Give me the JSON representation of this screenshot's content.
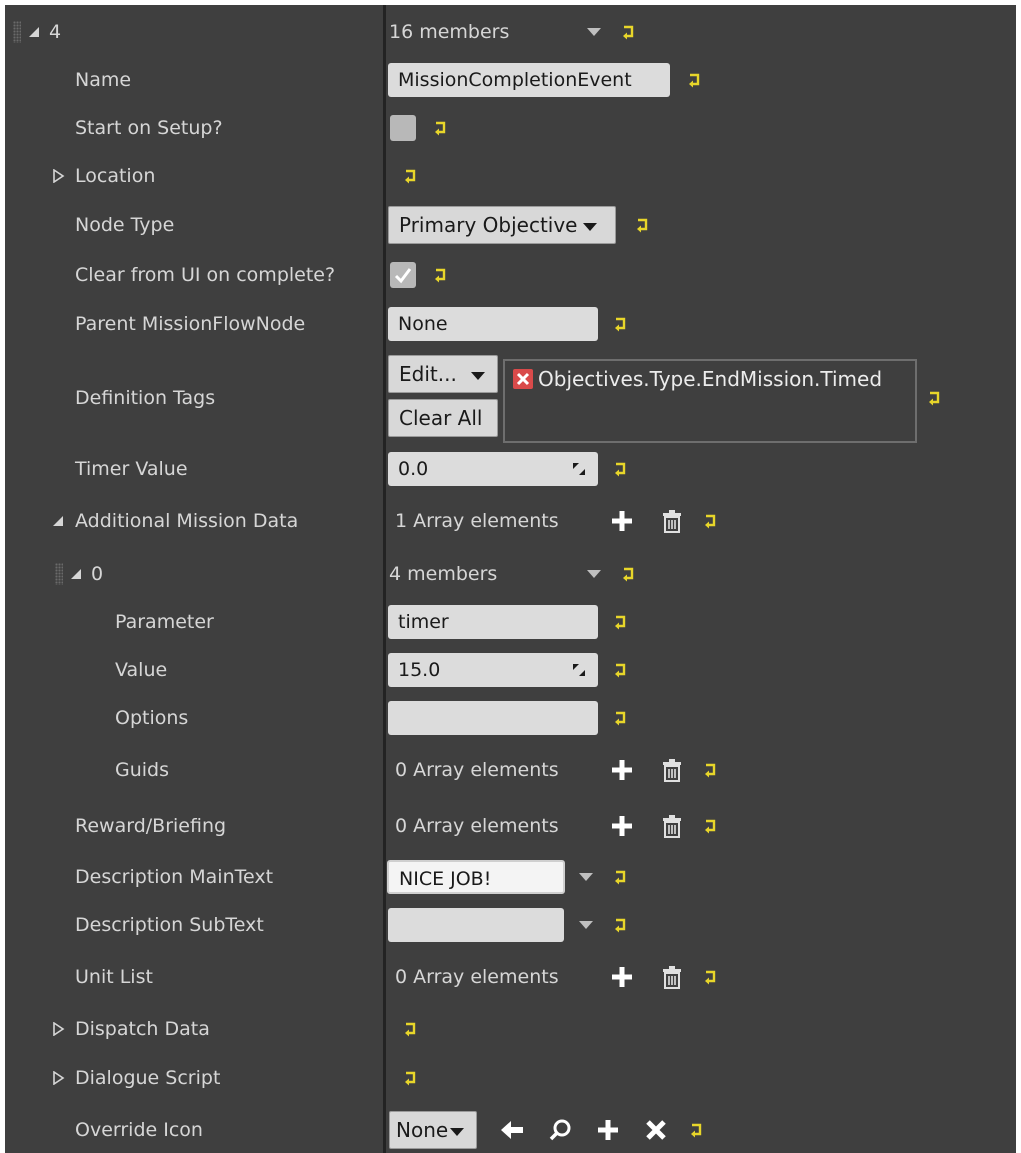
{
  "root": {
    "index": "4",
    "members": "16 members"
  },
  "rows": {
    "name": {
      "label": "Name",
      "value": "MissionCompletionEvent"
    },
    "start_on_setup": {
      "label": "Start on Setup?"
    },
    "location": {
      "label": "Location"
    },
    "node_type": {
      "label": "Node Type",
      "value": "Primary Objective"
    },
    "clear_from_ui": {
      "label": "Clear from UI on complete?",
      "checked": true
    },
    "parent_node": {
      "label": "Parent MissionFlowNode",
      "value": "None"
    },
    "definition_tags": {
      "label": "Definition Tags",
      "edit_label": "Edit...",
      "clear_label": "Clear All",
      "tag": "Objectives.Type.EndMission.Timed"
    },
    "timer_value": {
      "label": "Timer Value",
      "value": "0.0"
    },
    "additional_mission_data": {
      "label": "Additional Mission Data",
      "count": "1 Array elements"
    },
    "element0": {
      "index": "0",
      "members": "4 members"
    },
    "parameter": {
      "label": "Parameter",
      "value": "timer"
    },
    "value": {
      "label": "Value",
      "value": "15.0"
    },
    "options": {
      "label": "Options",
      "value": ""
    },
    "guids": {
      "label": "Guids",
      "count": "0 Array elements"
    },
    "reward_briefing": {
      "label": "Reward/Briefing",
      "count": "0 Array elements"
    },
    "desc_main": {
      "label": "Description MainText",
      "value": "NICE JOB!"
    },
    "desc_sub": {
      "label": "Description SubText",
      "value": ""
    },
    "unit_list": {
      "label": "Unit List",
      "count": "0 Array elements"
    },
    "dispatch_data": {
      "label": "Dispatch Data"
    },
    "dialogue_script": {
      "label": "Dialogue Script"
    },
    "override_icon": {
      "label": "Override Icon",
      "value": "None"
    }
  },
  "colors": {
    "panel_bg": "#3f3f3f",
    "reset_arrow": "#e8d62a",
    "field_bg": "#dcdcdc",
    "tag_remove": "#d94a4a"
  },
  "icons": {
    "reset": "reset-to-default-icon",
    "add": "plus-icon",
    "delete": "trash-icon",
    "back": "arrow-left-icon",
    "browse": "search-icon",
    "clear": "close-icon"
  }
}
